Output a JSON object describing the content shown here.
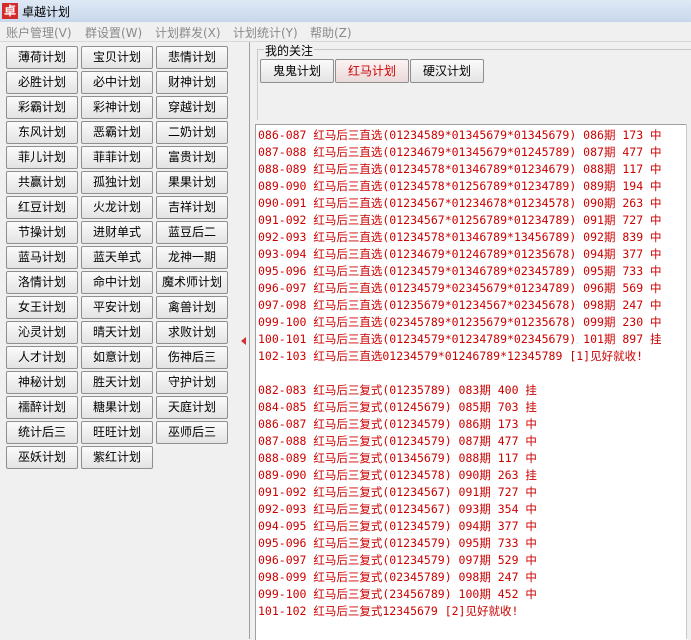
{
  "window": {
    "title": "卓越计划",
    "icon_char": "卓"
  },
  "menu": [
    "账户管理(V)",
    "群设置(W)",
    "计划群发(X)",
    "计划统计(Y)",
    "帮助(Z)"
  ],
  "plans": [
    "薄荷计划",
    "宝贝计划",
    "悲情计划",
    "必胜计划",
    "必中计划",
    "财神计划",
    "彩霸计划",
    "彩神计划",
    "穿越计划",
    "东风计划",
    "恶霸计划",
    "二奶计划",
    "菲儿计划",
    "菲菲计划",
    "富贵计划",
    "共赢计划",
    "孤独计划",
    "果果计划",
    "红豆计划",
    "火龙计划",
    "吉祥计划",
    "节操计划",
    "进财单式",
    "蓝豆后二",
    "蓝马计划",
    "蓝天单式",
    "龙神一期",
    "洛情计划",
    "命中计划",
    "魔术师计划",
    "女王计划",
    "平安计划",
    "禽兽计划",
    "沁灵计划",
    "晴天计划",
    "求败计划",
    "人才计划",
    "如意计划",
    "伤神后三",
    "神秘计划",
    "胜天计划",
    "守护计划",
    "襦醉计划",
    "糖果计划",
    "天庭计划",
    "统计后三",
    "旺旺计划",
    "巫师后三",
    "巫妖计划",
    "紫红计划"
  ],
  "follow": {
    "legend": "我的关注",
    "buttons": [
      "鬼鬼计划",
      "红马计划",
      "硬汉计划"
    ],
    "active": "红马计划"
  },
  "results": [
    "086-087 红马后三直选(01234589*01345679*01345679) 086期 173 中",
    "087-088 红马后三直选(01234679*01345679*01245789) 087期 477 中",
    "088-089 红马后三直选(01234578*01346789*01234679) 088期 117 中",
    "089-090 红马后三直选(01234578*01256789*01234789) 089期 194 中",
    "090-091 红马后三直选(01234567*01234678*01234578) 090期 263 中",
    "091-092 红马后三直选(01234567*01256789*01234789) 091期 727 中",
    "092-093 红马后三直选(01234578*01346789*13456789) 092期 839 中",
    "093-094 红马后三直选(01234679*01246789*01235678) 094期 377 中",
    "095-096 红马后三直选(01234579*01346789*02345789) 095期 733 中",
    "096-097 红马后三直选(01234579*02345679*01234789) 096期 569 中",
    "097-098 红马后三直选(01235679*01234567*02345678) 098期 247 中",
    "099-100 红马后三直选(02345789*01235679*01235678) 099期 230 中",
    "100-101 红马后三直选(01234579*01234789*02345679) 101期 897 挂",
    "102-103 红马后三直选01234579*01246789*12345789 [1]见好就收!",
    "",
    "082-083 红马后三复式(01235789) 083期 400 挂",
    "084-085 红马后三复式(01245679) 085期 703 挂",
    "086-087 红马后三复式(01234579) 086期 173 中",
    "087-088 红马后三复式(01234579) 087期 477 中",
    "088-089 红马后三复式(01345679) 088期 117 中",
    "089-090 红马后三复式(01234578) 090期 263 挂",
    "091-092 红马后三复式(01234567) 091期 727 中",
    "092-093 红马后三复式(01234567) 093期 354 中",
    "094-095 红马后三复式(01234579) 094期 377 中",
    "095-096 红马后三复式(01234579) 095期 733 中",
    "096-097 红马后三复式(01234579) 097期 529 中",
    "098-099 红马后三复式(02345789) 098期 247 中",
    "099-100 红马后三复式(23456789) 100期 452 中",
    "101-102 红马后三复式12345679 [2]见好就收!"
  ]
}
